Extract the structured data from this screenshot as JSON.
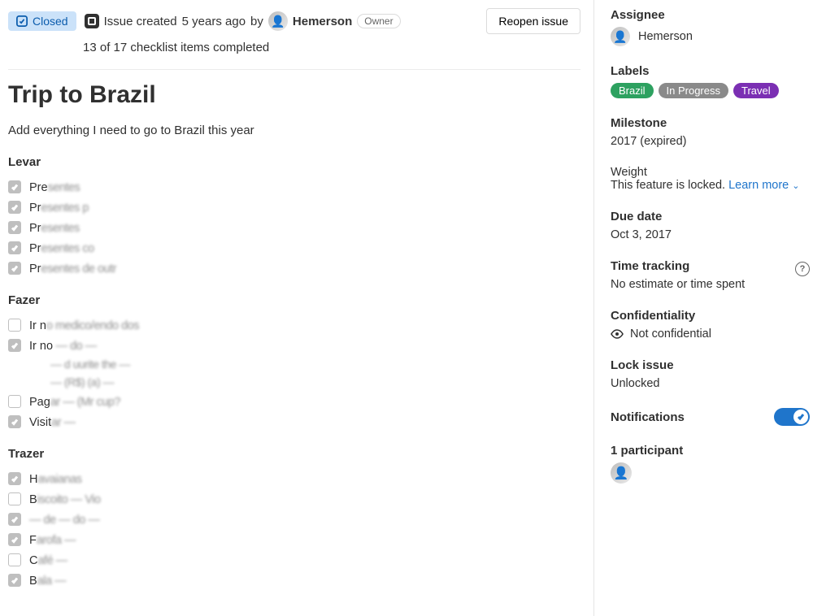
{
  "header": {
    "status": "Closed",
    "meta_prefix": "Issue created",
    "meta_time": "5 years ago",
    "meta_by": "by",
    "author": "Hemerson",
    "role": "Owner",
    "reopen_label": "Reopen issue",
    "checklist_progress": "13 of 17 checklist items completed"
  },
  "issue": {
    "title": "Trip to Brazil",
    "description": "Add everything I need to go to Brazil this year"
  },
  "sections": [
    {
      "heading": "Levar",
      "items": [
        {
          "checked": true,
          "text_prefix": "Pre",
          "text_obscured": "sentes"
        },
        {
          "checked": true,
          "text_prefix": "Pr",
          "text_obscured": "esentes p"
        },
        {
          "checked": true,
          "text_prefix": "Pr",
          "text_obscured": "esentes"
        },
        {
          "checked": true,
          "text_prefix": "Pr",
          "text_obscured": "esentes co"
        },
        {
          "checked": true,
          "text_prefix": "Pr",
          "text_obscured": "esentes de outr"
        }
      ]
    },
    {
      "heading": "Fazer",
      "items": [
        {
          "checked": false,
          "text_prefix": "Ir n",
          "text_obscured": "o medico/endo dos"
        },
        {
          "checked": true,
          "text_prefix": "Ir no",
          "text_obscured": " — do —",
          "nested": [
            "— d uurite the —",
            "— (R$) (a) —"
          ]
        },
        {
          "checked": false,
          "text_prefix": "Pag",
          "text_obscured": "ar — (Mr cup?"
        },
        {
          "checked": true,
          "text_prefix": "Visit",
          "text_obscured": "ar —"
        }
      ]
    },
    {
      "heading": "Trazer",
      "items": [
        {
          "checked": true,
          "text_prefix": "H",
          "text_obscured": "avaianas"
        },
        {
          "checked": false,
          "text_prefix": "B",
          "text_obscured": "iscoito — Vio"
        },
        {
          "checked": true,
          "text_prefix": "",
          "text_obscured": "— de — do —"
        },
        {
          "checked": true,
          "text_prefix": "F",
          "text_obscured": "arofa —"
        },
        {
          "checked": false,
          "text_prefix": "C",
          "text_obscured": "afé —"
        },
        {
          "checked": true,
          "text_prefix": "B",
          "text_obscured": "ala —"
        }
      ]
    }
  ],
  "sidebar": {
    "assignee_label": "Assignee",
    "assignee_name": "Hemerson",
    "labels_label": "Labels",
    "labels": [
      {
        "text": "Brazil",
        "color": "#2da160"
      },
      {
        "text": "In Progress",
        "color": "#8a8a8a"
      },
      {
        "text": "Travel",
        "color": "#7b2fb3"
      }
    ],
    "milestone_label": "Milestone",
    "milestone_value": "2017 (expired)",
    "weight_label": "Weight",
    "weight_text": "This feature is locked.",
    "weight_link": "Learn more",
    "duedate_label": "Due date",
    "duedate_value": "Oct 3, 2017",
    "timetracking_label": "Time tracking",
    "timetracking_value": "No estimate or time spent",
    "confidentiality_label": "Confidentiality",
    "confidentiality_value": "Not confidential",
    "lock_label": "Lock issue",
    "lock_value": "Unlocked",
    "notifications_label": "Notifications",
    "notifications_on": true,
    "participants_label": "1 participant"
  }
}
